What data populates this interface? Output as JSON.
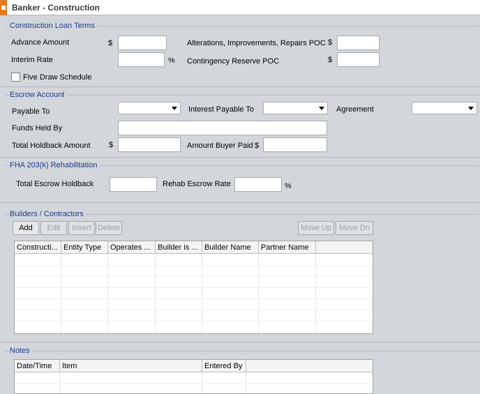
{
  "window": {
    "title": "Banker - Construction"
  },
  "construction_loan_terms": {
    "title": "Construction Loan Terms",
    "advance_amount_label": "Advance Amount",
    "interim_rate_label": "Interim Rate",
    "five_draw_label": "Five Draw Schedule",
    "alterations_label": "Alterations, Improvements, Repairs POC",
    "contingency_label": "Contingency Reserve POC",
    "dollar": "$",
    "percent": "%"
  },
  "escrow_account": {
    "title": "Escrow Account",
    "payable_to_label": "Payable To",
    "interest_payable_to_label": "Interest Payable To",
    "agreement_label": "Agreement",
    "funds_held_by_label": "Funds Held By",
    "total_holdback_label": "Total Holdback Amount",
    "amount_buyer_paid_label": "Amount Buyer Paid",
    "dollar": "$"
  },
  "fha": {
    "title": "FHA 203(k) Rehabilitation",
    "total_escrow_holdback_label": "Total Escrow Holdback",
    "rehab_escrow_rate_label": "Rehab Escrow Rate",
    "percent": "%"
  },
  "builders": {
    "title": "Builders / Contractors",
    "buttons": {
      "add": "Add",
      "edit": "Edit",
      "insert": "Insert",
      "delete": "Delete",
      "move_up": "Move Up",
      "move_dn": "Move Dn"
    },
    "columns": [
      "Constructi...",
      "Entity Type",
      "Operates ...",
      "Builder is ...",
      "Builder Name",
      "Partner Name"
    ]
  },
  "notes": {
    "title": "Notes",
    "columns": [
      "Date/Time",
      "Item",
      "Entered By"
    ]
  }
}
